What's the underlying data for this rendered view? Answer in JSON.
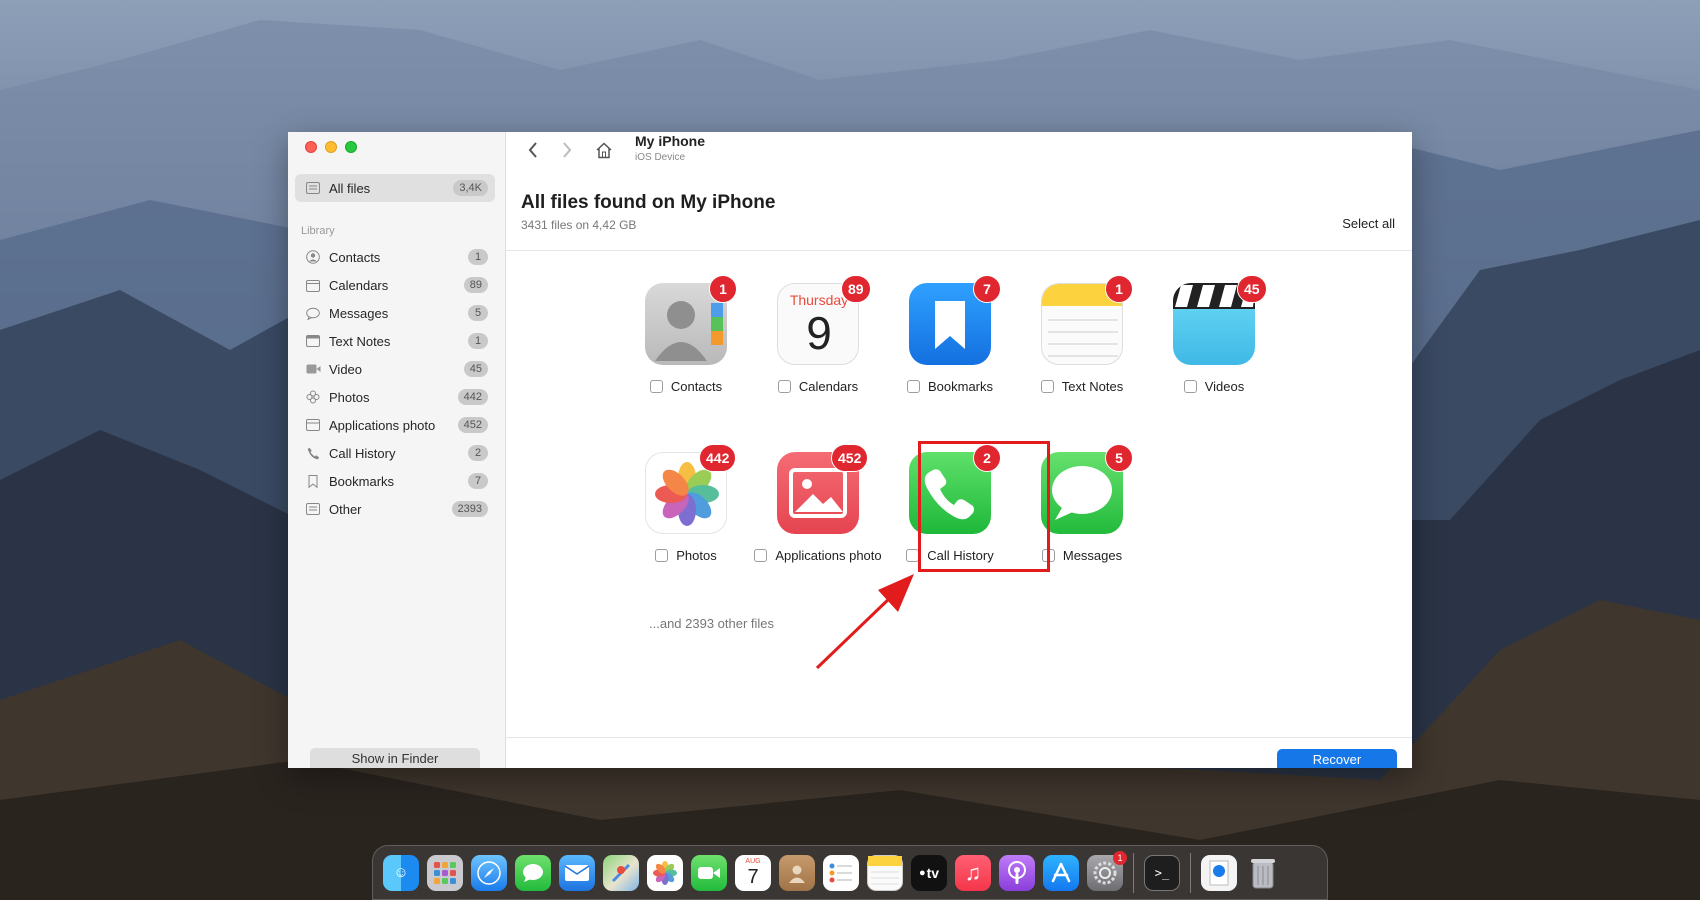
{
  "window": {
    "device_title": "My iPhone",
    "device_subtitle": "iOS Device"
  },
  "sidebar": {
    "all_files": {
      "label": "All files",
      "count": "3,4K"
    },
    "section_title": "Library",
    "items": [
      {
        "label": "Contacts",
        "count": "1",
        "icon": "person-circle-icon"
      },
      {
        "label": "Calendars",
        "count": "89",
        "icon": "calendar-icon"
      },
      {
        "label": "Messages",
        "count": "5",
        "icon": "speech-bubble-icon"
      },
      {
        "label": "Text Notes",
        "count": "1",
        "icon": "note-icon"
      },
      {
        "label": "Video",
        "count": "45",
        "icon": "video-camera-icon"
      },
      {
        "label": "Photos",
        "count": "442",
        "icon": "flower-icon"
      },
      {
        "label": "Applications photo",
        "count": "452",
        "icon": "photo-frame-icon"
      },
      {
        "label": "Call History",
        "count": "2",
        "icon": "phone-icon"
      },
      {
        "label": "Bookmarks",
        "count": "7",
        "icon": "bookmark-icon"
      },
      {
        "label": "Other",
        "count": "2393",
        "icon": "folder-icon"
      }
    ],
    "show_in_finder": "Show in Finder"
  },
  "main": {
    "title": "All files found on My iPhone",
    "subtitle": "3431 files on 4,42 GB",
    "select_all": "Select all",
    "other_files": "...and 2393 other files",
    "recover": "Recover",
    "calendar_day_name": "Thursday",
    "calendar_day_number": "9",
    "tiles": [
      {
        "label": "Contacts",
        "count": "1"
      },
      {
        "label": "Calendars",
        "count": "89"
      },
      {
        "label": "Bookmarks",
        "count": "7"
      },
      {
        "label": "Text Notes",
        "count": "1"
      },
      {
        "label": "Videos",
        "count": "45"
      },
      {
        "label": "Photos",
        "count": "442"
      },
      {
        "label": "Applications photo",
        "count": "452"
      },
      {
        "label": "Call History",
        "count": "2"
      },
      {
        "label": "Messages",
        "count": "5"
      }
    ]
  },
  "dock": {
    "calendar_month": "AUG",
    "calendar_day": "7",
    "tv_label": "tv",
    "settings_badge": "1"
  },
  "colors": {
    "accent_blue": "#1677e9",
    "badge_red": "#e0262e",
    "highlight_red": "#e21c1c"
  }
}
